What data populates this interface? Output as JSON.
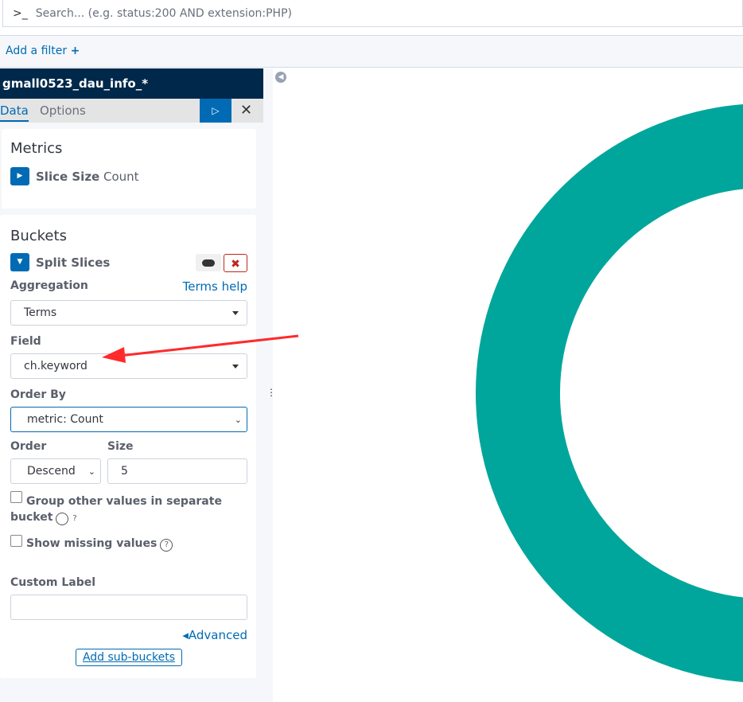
{
  "search": {
    "prompt": ">_",
    "placeholder": "Search... (e.g. status:200 AND extension:PHP)"
  },
  "filter": {
    "add_label": "Add a filter",
    "add_icon": "+"
  },
  "sidebar": {
    "index_pattern": "gmall0523_dau_info_*",
    "tabs": [
      {
        "label": "Data",
        "active": true
      },
      {
        "label": "Options"
      }
    ],
    "metrics": {
      "title": "Metrics",
      "item_name": "Slice Size",
      "item_value": "Count"
    },
    "buckets": {
      "title": "Buckets",
      "item_name": "Split Slices",
      "aggregation_label": "Aggregation",
      "help_link": "Terms help",
      "aggregation_value": "Terms",
      "field_label": "Field",
      "field_value": "ch.keyword",
      "order_by_label": "Order By",
      "order_by_value": "metric: Count",
      "order_label": "Order",
      "order_value": "Descend",
      "size_label": "Size",
      "size_value": "5",
      "group_other_label": "Group other values in separate bucket",
      "show_missing_label": "Show missing values",
      "custom_label_label": "Custom Label",
      "custom_label_value": "",
      "advanced_link": "Advanced",
      "add_sub_buckets": "Add sub-buckets"
    }
  },
  "colors": {
    "accent": "#006bb4",
    "header": "#00284a",
    "donut": "#00a69b",
    "annotation": "#ff2a2a"
  }
}
